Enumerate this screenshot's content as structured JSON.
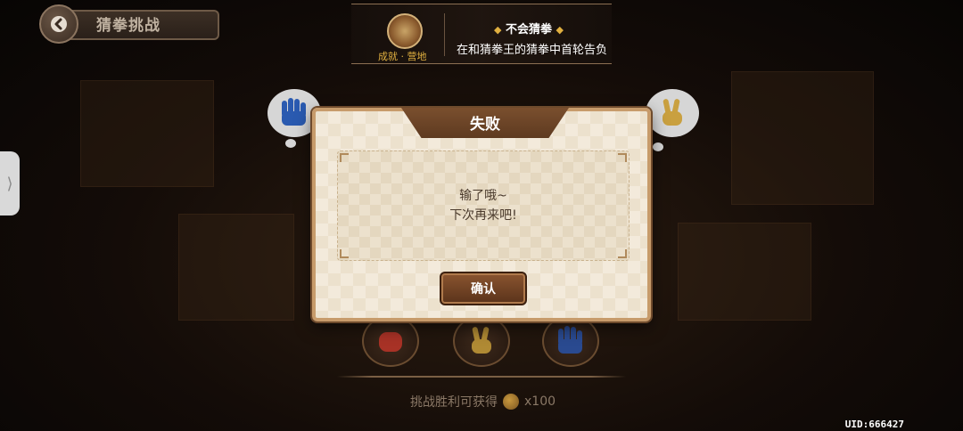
{
  "header": {
    "title": "猜拳挑战"
  },
  "achievement_toast": {
    "badge_label": "成就 · 营地",
    "title": "不会猜拳",
    "description": "在和猜拳王的猜拳中首轮告负"
  },
  "opponent_hands": {
    "left": "paper",
    "right": "scissors"
  },
  "modal": {
    "title": "失败",
    "message_line1": "输了哦~",
    "message_line2": "下次再来吧!",
    "confirm_label": "确认"
  },
  "choices": [
    "rock",
    "scissors",
    "paper"
  ],
  "reward": {
    "label": "挑战胜利可获得",
    "amount": "x100"
  },
  "uid": "UID:666427",
  "colors": {
    "accent_gold": "#e0b040",
    "modal_border": "#c79b6b",
    "button_brown": "#7a4a28"
  }
}
